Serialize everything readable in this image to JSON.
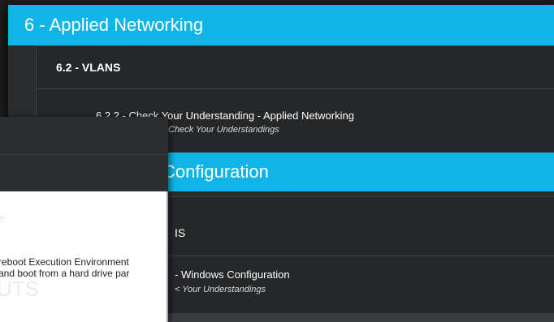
{
  "modules": [
    {
      "header": "6 - Applied Networking",
      "section": "6.2 - VLANS",
      "topic_title": "6.2.2 - Check Your Understanding - Applied Networking",
      "topic_sub": "Check Your Understandings"
    },
    {
      "header": "Configuration",
      "section": "IS",
      "topic_title": "- Windows Configuration",
      "topic_sub": "< Your Understandings"
    }
  ],
  "overlay": {
    "faded_label": "e",
    "line1": "reboot Execution Environment",
    "line2": " and boot from a hard drive par",
    "faded_big": "UTS"
  },
  "colors": {
    "header_blue": "#10b4e6",
    "panel_dark": "#2a2b2d",
    "overlay_bg": "#ffffff"
  }
}
